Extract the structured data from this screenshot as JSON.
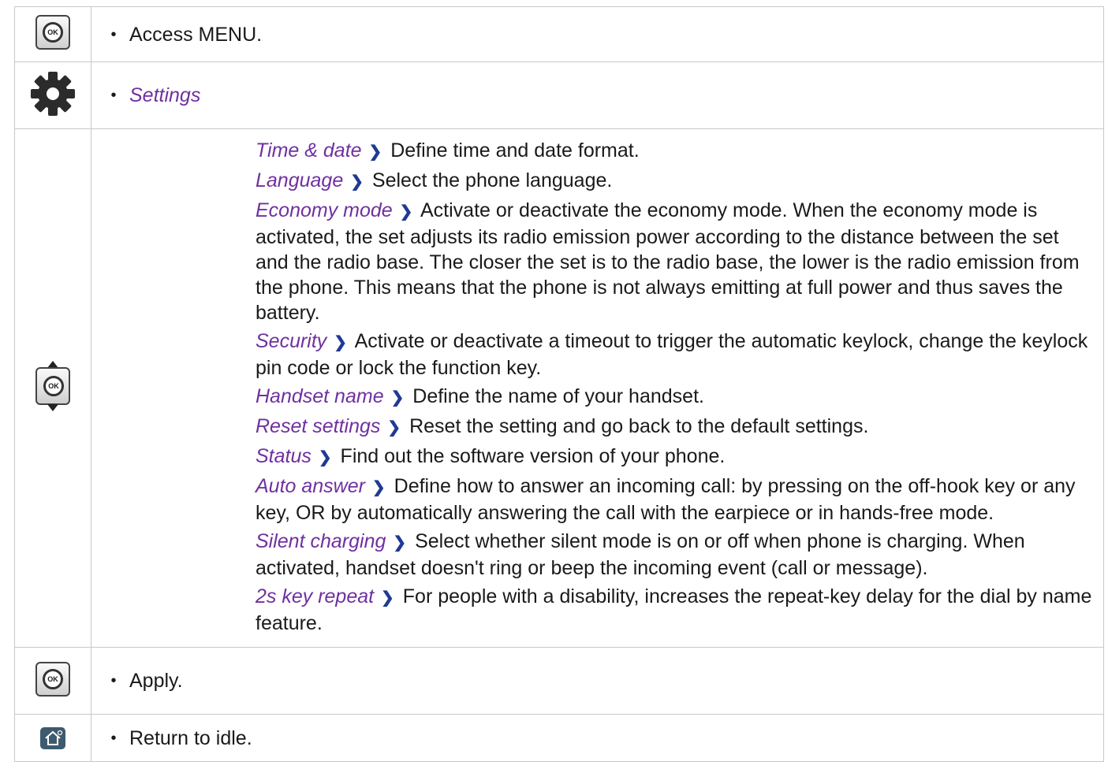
{
  "rows": [
    {
      "icon": "ok-key-icon",
      "text": "Access MENU."
    },
    {
      "icon": "settings-gear-icon",
      "text": "Settings"
    },
    {
      "icon": "navigator-key-icon"
    },
    {
      "icon": "ok-key-icon",
      "text": "Apply."
    },
    {
      "icon": "home-key-icon",
      "text": "Return to idle."
    }
  ],
  "ok_glyph": "OK",
  "arrow_glyph": "❯",
  "bullet_glyph": "•",
  "settings_items": [
    {
      "name": "Time & date",
      "desc": "Define time and date format."
    },
    {
      "name": "Language",
      "desc": "Select the phone language."
    },
    {
      "name": "Economy mode",
      "desc": "Activate or deactivate the economy mode. When the economy mode is activated, the set adjusts its radio emission power according to the distance between the set and the radio base. The closer the set is to the radio base, the lower is the radio emission from the phone. This means that the phone is not always emitting at full power and thus saves the battery."
    },
    {
      "name": "Security",
      "desc": "Activate or deactivate a timeout to trigger the automatic keylock, change the keylock pin code or lock the function key."
    },
    {
      "name": "Handset name",
      "desc": "Define the name of your handset."
    },
    {
      "name": "Reset settings",
      "desc": "Reset the setting and go back to the default settings."
    },
    {
      "name": "Status",
      "desc": "Find out the software version of your phone."
    },
    {
      "name": "Auto answer",
      "desc": "Define how to answer an incoming call: by pressing on the off-hook key or any key, OR by automatically answering the call with the earpiece or in hands-free mode."
    },
    {
      "name": "Silent charging",
      "desc": "Select whether silent mode is on or off when phone is charging. When activated, handset doesn't ring or beep the incoming event (call or message)."
    },
    {
      "name": "2s key repeat",
      "desc": "For people with a disability, increases the repeat-key delay for the dial by name feature."
    }
  ],
  "colors": {
    "accent_purple": "#7030a0",
    "arrow_blue": "#1f3a93",
    "border": "#c8c8c8",
    "home_key": "#3d5a6e"
  }
}
